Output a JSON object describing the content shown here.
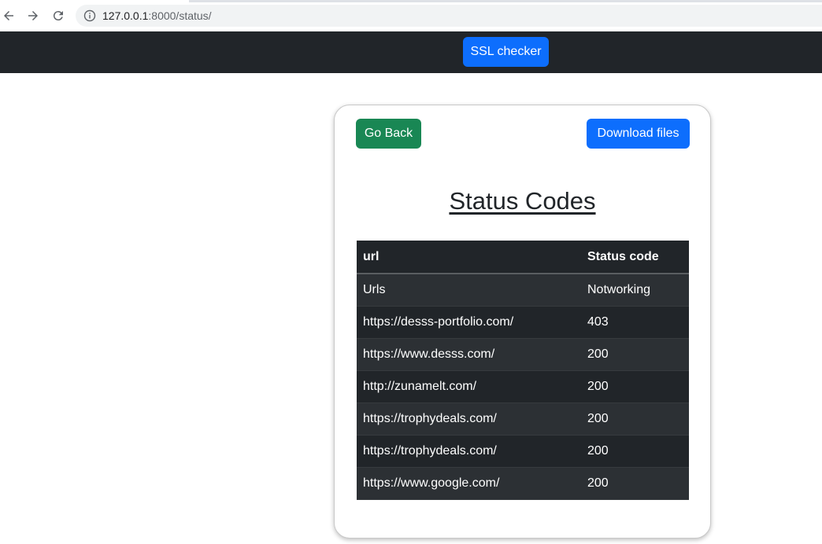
{
  "browser": {
    "url_host": "127.0.0.1",
    "url_path": ":8000/status/"
  },
  "navbar": {
    "ssl_checker_label": "SSL checker"
  },
  "card": {
    "go_back_label": "Go Back",
    "download_label": "Download files",
    "title": "Status Codes"
  },
  "table": {
    "headers": [
      "url",
      "Status code"
    ],
    "rows": [
      {
        "url": "Urls",
        "status": "Notworking"
      },
      {
        "url": "https://desss-portfolio.com/",
        "status": "403"
      },
      {
        "url": "https://www.desss.com/",
        "status": "200"
      },
      {
        "url": "http://zunamelt.com/",
        "status": "200"
      },
      {
        "url": "https://trophydeals.com/",
        "status": "200"
      },
      {
        "url": "https://trophydeals.com/",
        "status": "200"
      },
      {
        "url": "https://www.google.com/",
        "status": "200"
      }
    ]
  },
  "colors": {
    "navbar_bg": "#212529",
    "primary": "#0d6efd",
    "success": "#198754"
  }
}
